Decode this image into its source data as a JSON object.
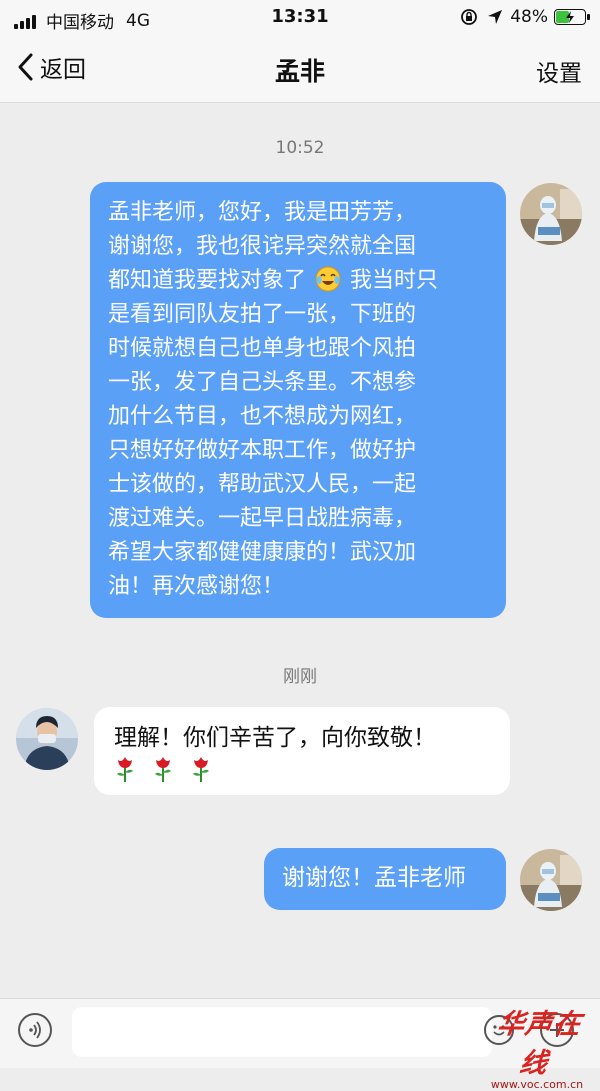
{
  "status_bar": {
    "carrier": "中国移动",
    "network": "4G",
    "time": "13:31",
    "battery": "48%",
    "battery_level": 0.48
  },
  "nav": {
    "back_label": "返回",
    "title": "孟非",
    "settings_label": "设置"
  },
  "messages": [
    {
      "time_label": "10:52",
      "direction": "outgoing",
      "lines": [
        "孟非老师，您好，我是田芳芳，",
        "谢谢您，我也很诧异突然就全国",
        "都知道我要找对象了",
        "我当时只",
        "是看到同队友拍了一张，下班的",
        "时候就想自己也单身也跟个风拍",
        "一张，发了自己头条里。不想参",
        "加什么节目，也不想成为网红，",
        "只想好好做好本职工作，做好护",
        "士该做的，帮助武汉人民，一起",
        "渡过难关。一起早日战胜病毒，",
        "希望大家都健健康康的！武汉加",
        "油！再次感谢您！"
      ],
      "inline_emoji": "crying-laughing-emoji"
    },
    {
      "time_label": "刚刚",
      "direction": "incoming",
      "text": "理解！你们辛苦了，向你致敬！",
      "emoji": [
        "rose-emoji",
        "rose-emoji",
        "rose-emoji"
      ]
    },
    {
      "direction": "outgoing",
      "text": "谢谢您！孟非老师"
    }
  ],
  "input_bar": {
    "icons": [
      "voice-icon",
      "emoji-icon",
      "plus-icon"
    ],
    "placeholder": ""
  },
  "watermark": {
    "logo_text": "华声在线",
    "url": "www.voc.com.cn"
  },
  "colors": {
    "outgoing_bubble": "#5aa0f7",
    "incoming_bubble": "#ffffff",
    "background": "#ededed"
  }
}
